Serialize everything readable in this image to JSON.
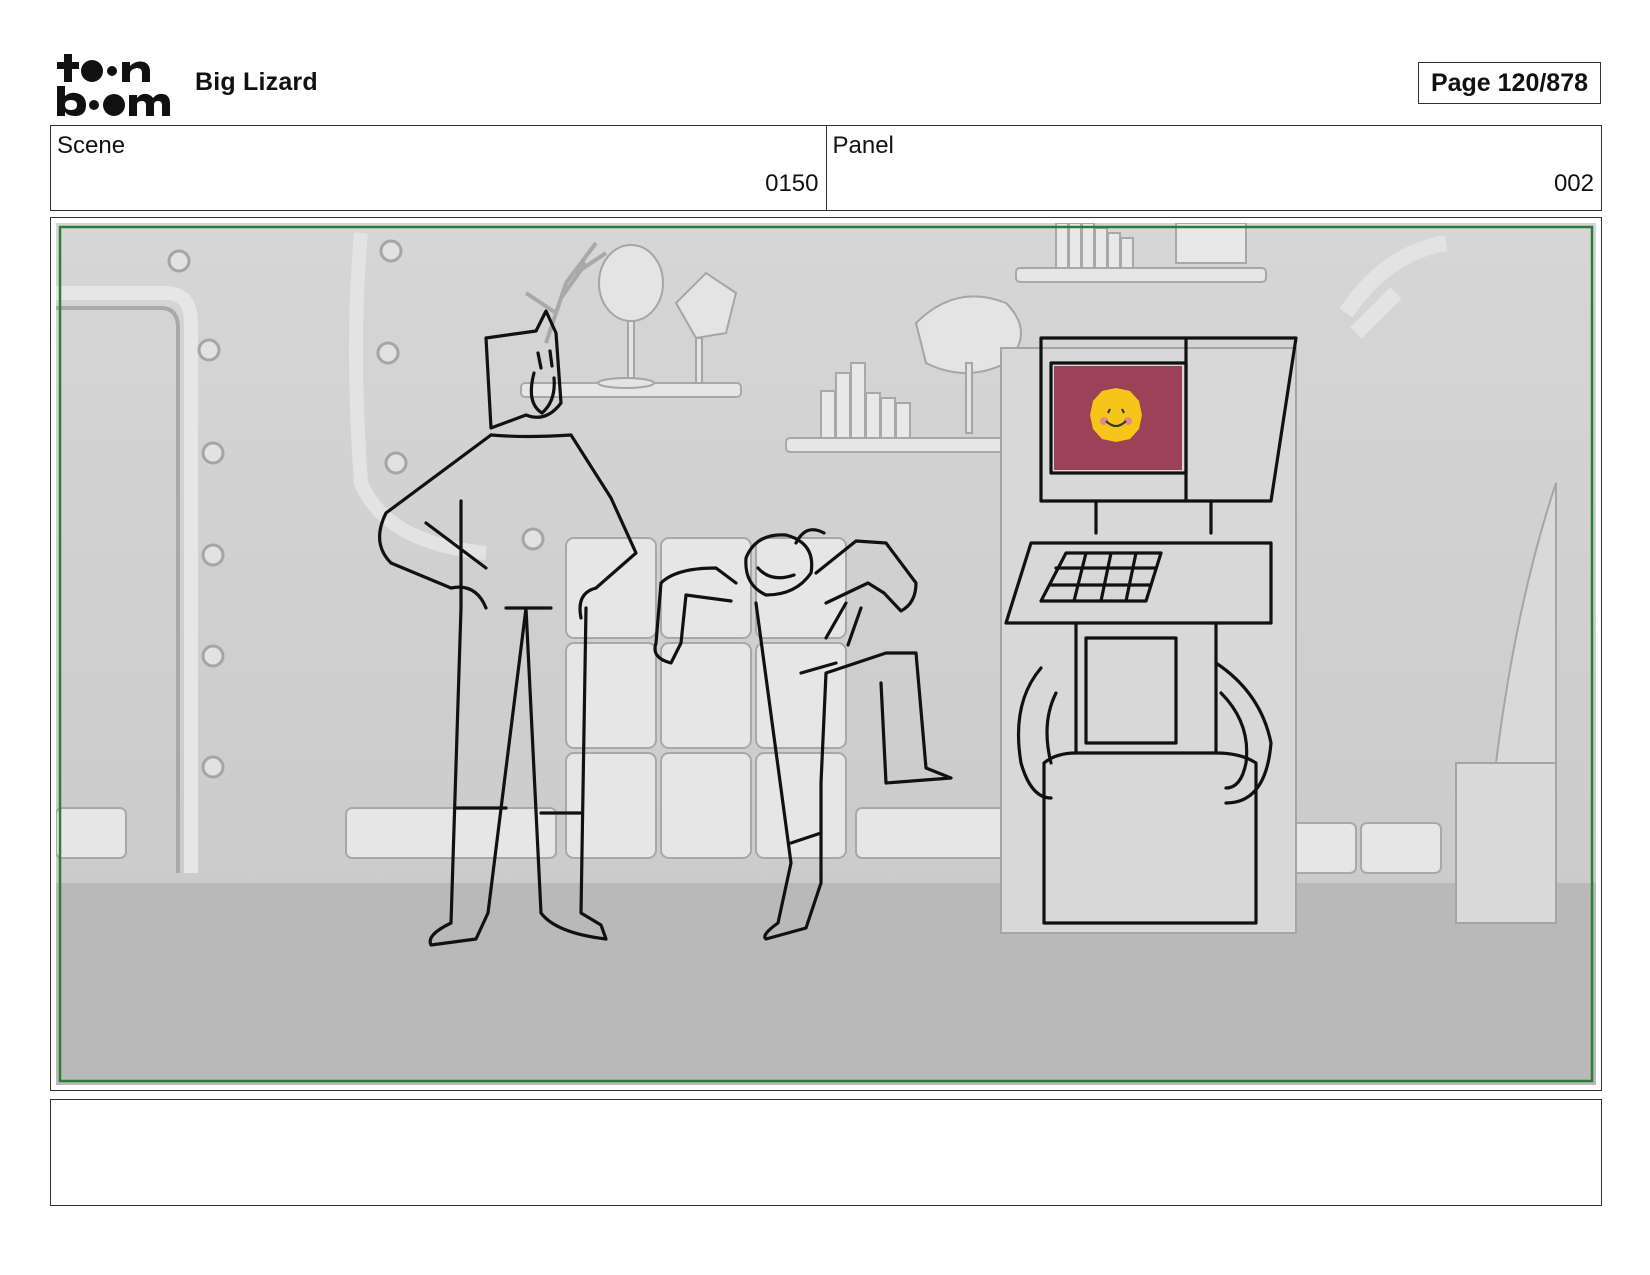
{
  "header": {
    "logo": {
      "text": "toonboom",
      "icon": "toonboom-logo"
    },
    "project_title": "Big Lizard",
    "page_label": "Page 120/878"
  },
  "info": {
    "scene": {
      "label": "Scene",
      "value": "0150"
    },
    "panel": {
      "label": "Panel",
      "value": "002"
    }
  },
  "panel_image": {
    "description_icon": "storyboard-sketch",
    "frame_color": "#2e7d32",
    "screen_color": "#9c4258",
    "face_color": "#f5c518"
  },
  "notes": {
    "text": ""
  }
}
